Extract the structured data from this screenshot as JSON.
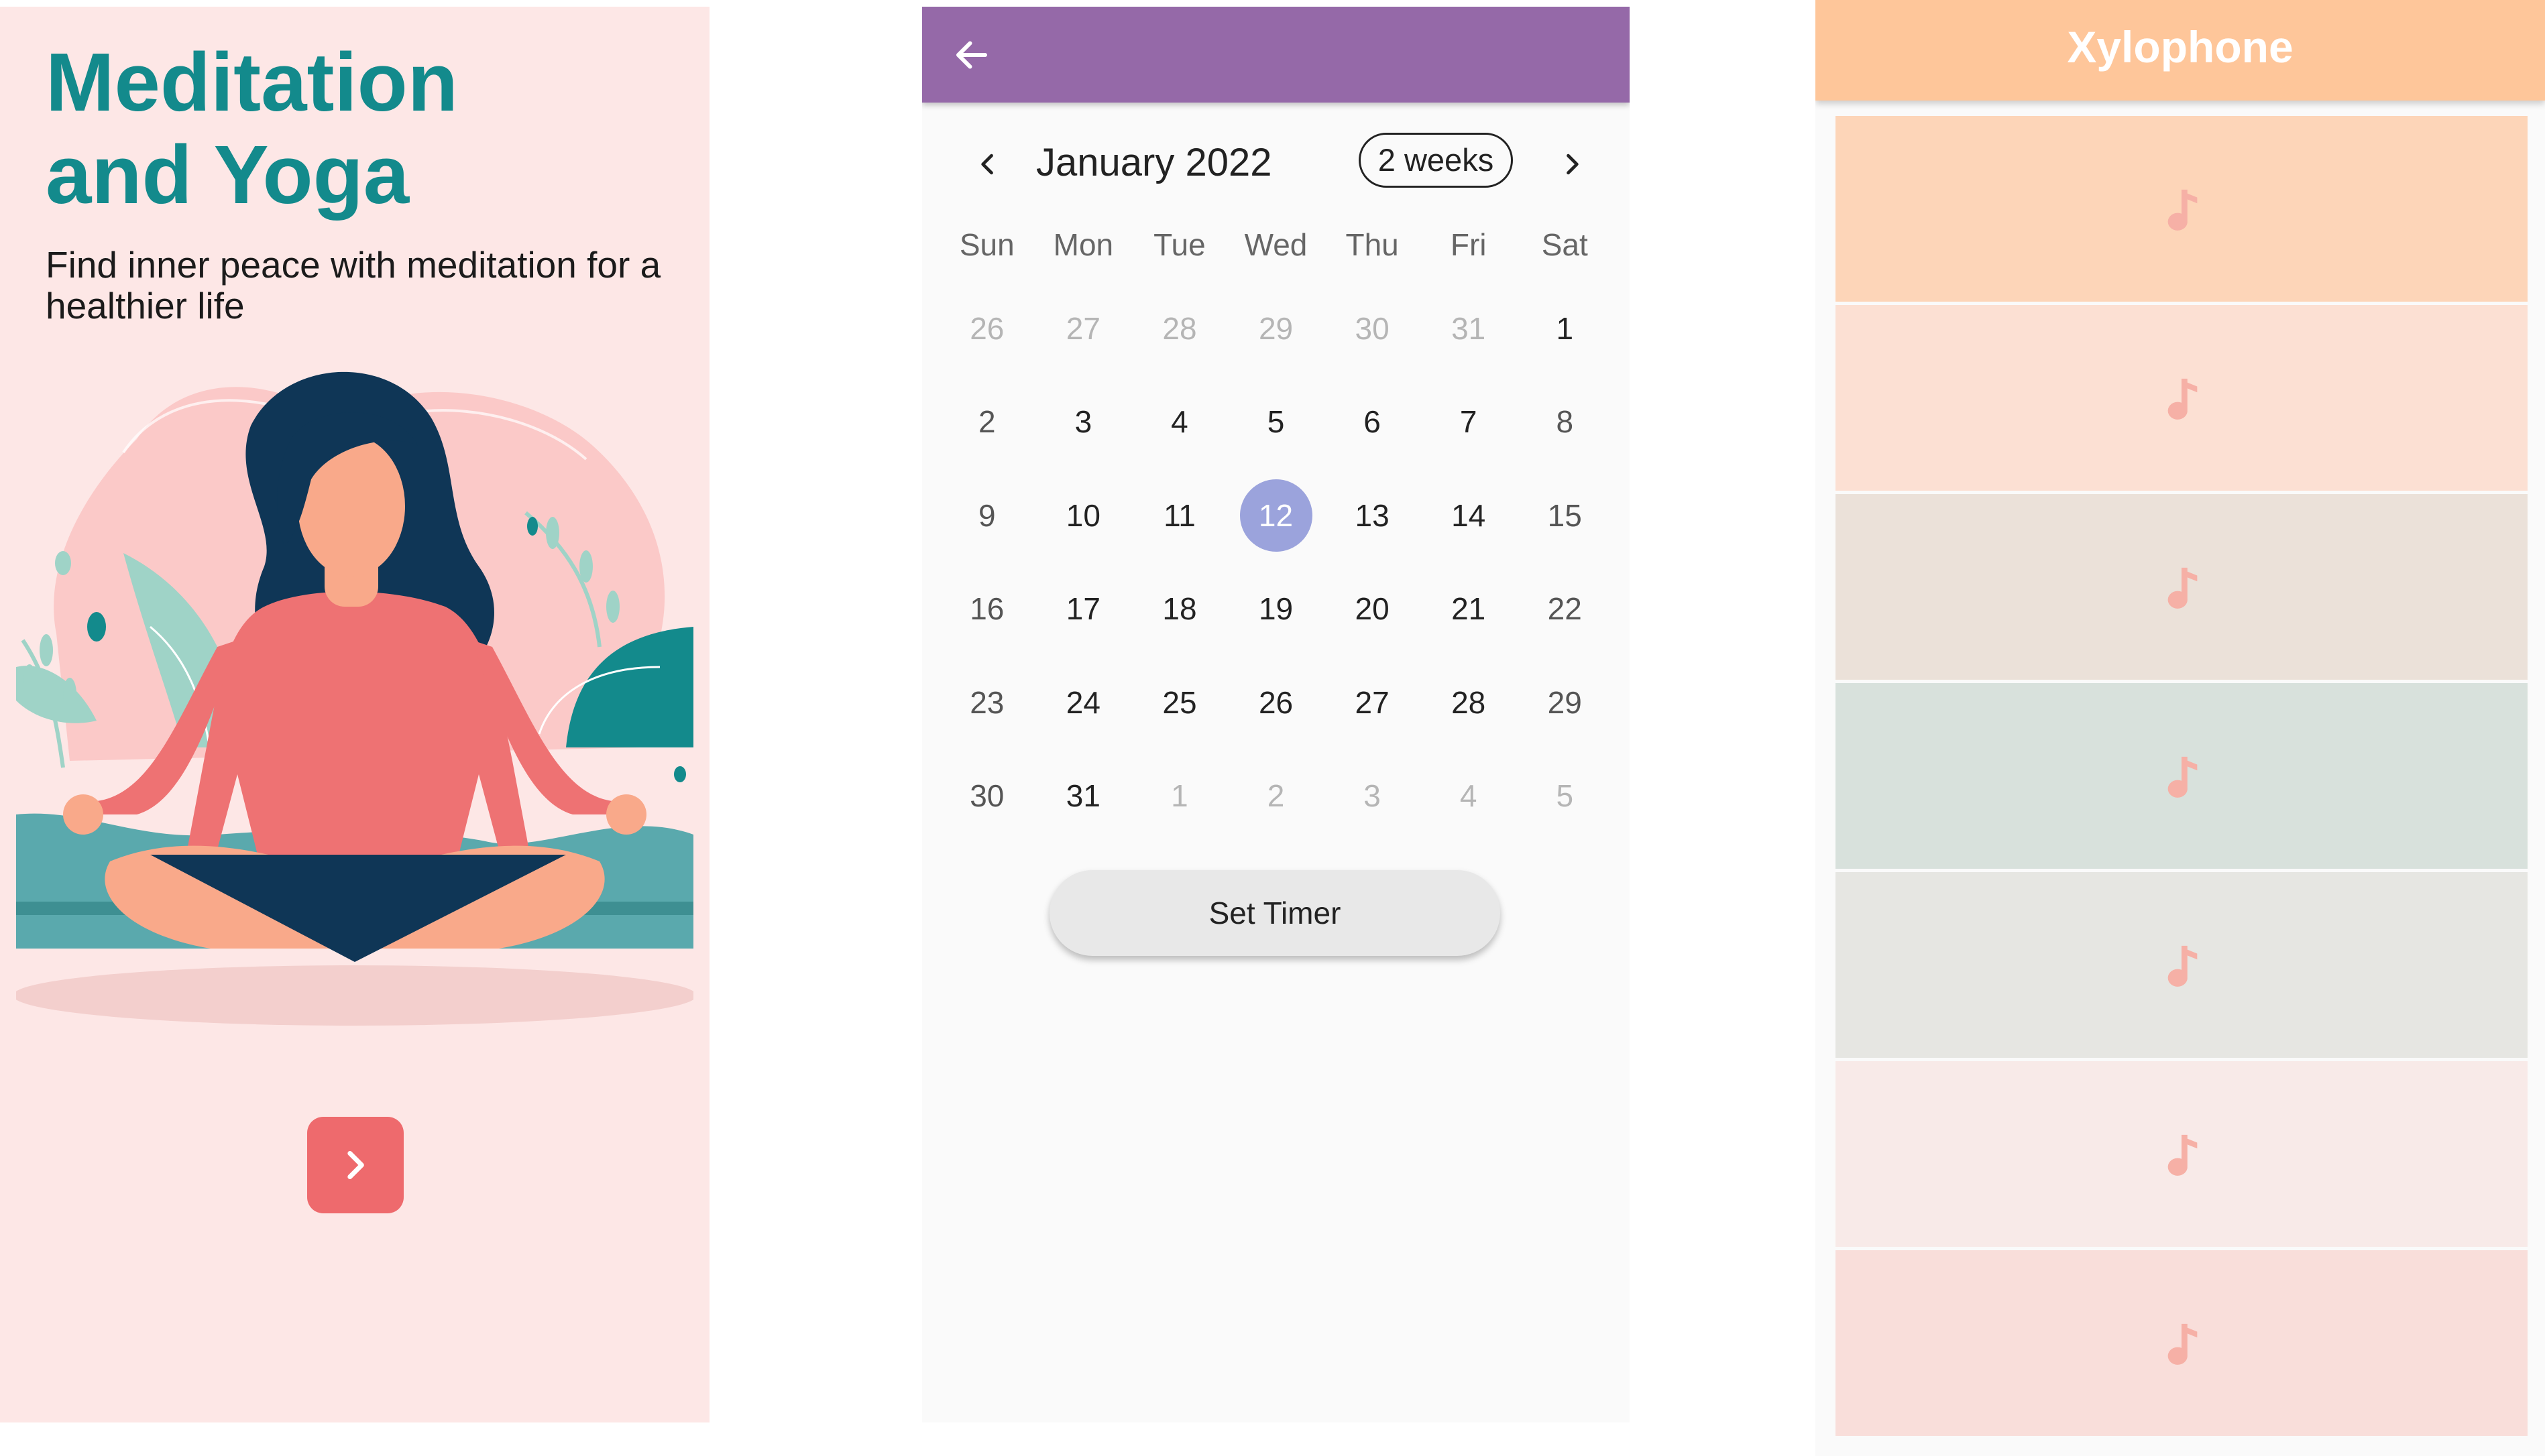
{
  "meditation": {
    "title_line1": "Meditation",
    "title_line2": "and Yoga",
    "subtitle": "Find inner peace with meditation for a healthier life",
    "next_icon": "chevron-right-icon",
    "colors": {
      "background": "#fde7e6",
      "title": "#138a8c",
      "button": "#ee6a6d"
    }
  },
  "calendar": {
    "back_icon": "arrow-left-icon",
    "month_label": "January 2022",
    "format_button": "2 weeks",
    "prev_icon": "chevron-left-icon",
    "next_icon": "chevron-right-icon",
    "weekdays": [
      "Sun",
      "Mon",
      "Tue",
      "Wed",
      "Thu",
      "Fri",
      "Sat"
    ],
    "weeks": [
      [
        "26",
        "27",
        "28",
        "29",
        "30",
        "31",
        "1"
      ],
      [
        "2",
        "3",
        "4",
        "5",
        "6",
        "7",
        "8"
      ],
      [
        "9",
        "10",
        "11",
        "12",
        "13",
        "14",
        "15"
      ],
      [
        "16",
        "17",
        "18",
        "19",
        "20",
        "21",
        "22"
      ],
      [
        "23",
        "24",
        "25",
        "26",
        "27",
        "28",
        "29"
      ],
      [
        "30",
        "31",
        "1",
        "2",
        "3",
        "4",
        "5"
      ]
    ],
    "selected_day": "12",
    "set_timer_label": "Set Timer",
    "colors": {
      "appbar": "#9569a8",
      "selected": "#9ba3dc"
    }
  },
  "xylophone": {
    "title": "Xylophone",
    "key_icon": "music-note-icon",
    "keys": [
      {
        "color": "#fdd5b8"
      },
      {
        "color": "#fce0d3"
      },
      {
        "color": "#ebe1d9"
      },
      {
        "color": "#d8e1dc"
      },
      {
        "color": "#e6e6e2"
      },
      {
        "color": "#f8eae8"
      },
      {
        "color": "#f9deda"
      }
    ],
    "colors": {
      "appbar": "#fec69a",
      "note": "#f6b0a6"
    }
  }
}
